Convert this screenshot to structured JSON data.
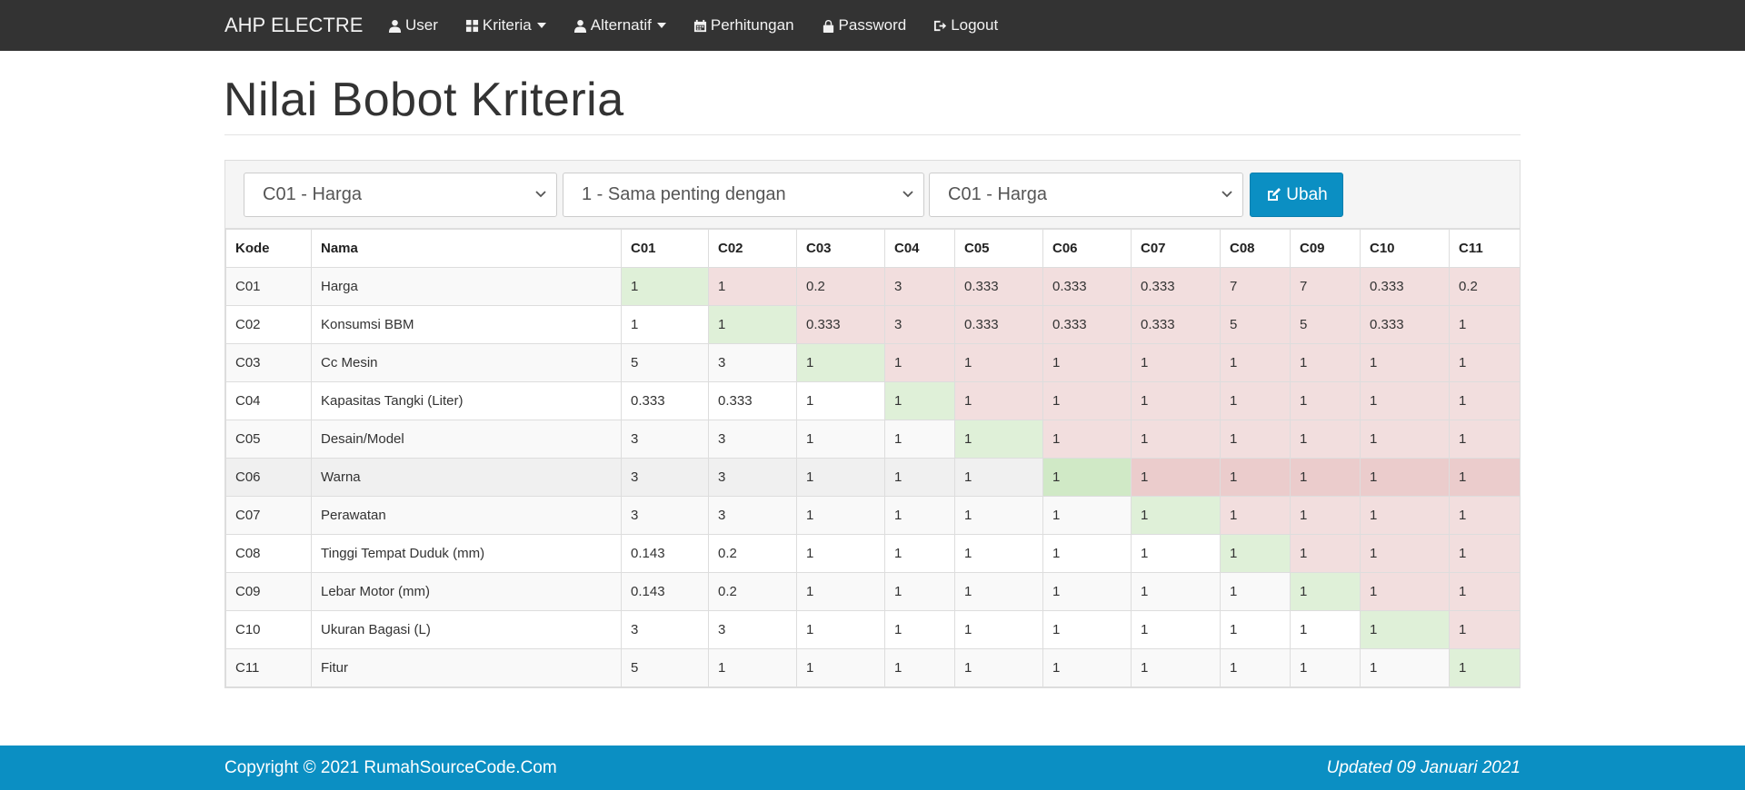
{
  "navbar": {
    "brand": "AHP ELECTRE",
    "items": [
      {
        "label": "User",
        "icon": "user-icon",
        "dropdown": false
      },
      {
        "label": "Kriteria",
        "icon": "grid-icon",
        "dropdown": true
      },
      {
        "label": "Alternatif",
        "icon": "user-icon",
        "dropdown": true
      },
      {
        "label": "Perhitungan",
        "icon": "calendar-icon",
        "dropdown": false
      },
      {
        "label": "Password",
        "icon": "lock-icon",
        "dropdown": false
      },
      {
        "label": "Logout",
        "icon": "logout-icon",
        "dropdown": false
      }
    ]
  },
  "page": {
    "title": "Nilai Bobot Kriteria"
  },
  "form": {
    "kriteria1": "C01 - Harga",
    "nilai": "1 - Sama penting dengan",
    "kriteria2": "C01 - Harga",
    "button_label": "Ubah",
    "button_icon": "edit-icon"
  },
  "table": {
    "headers": [
      "Kode",
      "Nama",
      "C01",
      "C02",
      "C03",
      "C04",
      "C05",
      "C06",
      "C07",
      "C08",
      "C09",
      "C10",
      "C11"
    ],
    "rows": [
      {
        "kode": "C01",
        "nama": "Harga",
        "values": [
          "1",
          "1",
          "0.2",
          "3",
          "0.333",
          "0.333",
          "0.333",
          "7",
          "7",
          "0.333",
          "0.2"
        ]
      },
      {
        "kode": "C02",
        "nama": "Konsumsi BBM",
        "values": [
          "1",
          "1",
          "0.333",
          "3",
          "0.333",
          "0.333",
          "0.333",
          "5",
          "5",
          "0.333",
          "1"
        ]
      },
      {
        "kode": "C03",
        "nama": "Cc Mesin",
        "values": [
          "5",
          "3",
          "1",
          "1",
          "1",
          "1",
          "1",
          "1",
          "1",
          "1",
          "1"
        ]
      },
      {
        "kode": "C04",
        "nama": "Kapasitas Tangki (Liter)",
        "values": [
          "0.333",
          "0.333",
          "1",
          "1",
          "1",
          "1",
          "1",
          "1",
          "1",
          "1",
          "1"
        ]
      },
      {
        "kode": "C05",
        "nama": "Desain/Model",
        "values": [
          "3",
          "3",
          "1",
          "1",
          "1",
          "1",
          "1",
          "1",
          "1",
          "1",
          "1"
        ]
      },
      {
        "kode": "C06",
        "nama": "Warna",
        "values": [
          "3",
          "3",
          "1",
          "1",
          "1",
          "1",
          "1",
          "1",
          "1",
          "1",
          "1"
        ]
      },
      {
        "kode": "C07",
        "nama": "Perawatan",
        "values": [
          "3",
          "3",
          "1",
          "1",
          "1",
          "1",
          "1",
          "1",
          "1",
          "1",
          "1"
        ]
      },
      {
        "kode": "C08",
        "nama": "Tinggi Tempat Duduk (mm)",
        "values": [
          "0.143",
          "0.2",
          "1",
          "1",
          "1",
          "1",
          "1",
          "1",
          "1",
          "1",
          "1"
        ]
      },
      {
        "kode": "C09",
        "nama": "Lebar Motor (mm)",
        "values": [
          "0.143",
          "0.2",
          "1",
          "1",
          "1",
          "1",
          "1",
          "1",
          "1",
          "1",
          "1"
        ]
      },
      {
        "kode": "C10",
        "nama": "Ukuran Bagasi (L)",
        "values": [
          "3",
          "3",
          "1",
          "1",
          "1",
          "1",
          "1",
          "1",
          "1",
          "1",
          "1"
        ]
      },
      {
        "kode": "C11",
        "nama": "Fitur",
        "values": [
          "5",
          "1",
          "1",
          "1",
          "1",
          "1",
          "1",
          "1",
          "1",
          "1",
          "1"
        ]
      }
    ]
  },
  "footer": {
    "copyright": "Copyright © 2021 RumahSourceCode.Com",
    "updated": "Updated 09 Januari 2021"
  },
  "colors": {
    "navbar_bg": "#333333",
    "accent": "#0b8fc3",
    "diagonal_cell": "#dff0d8",
    "upper_cell": "#f2dede"
  }
}
